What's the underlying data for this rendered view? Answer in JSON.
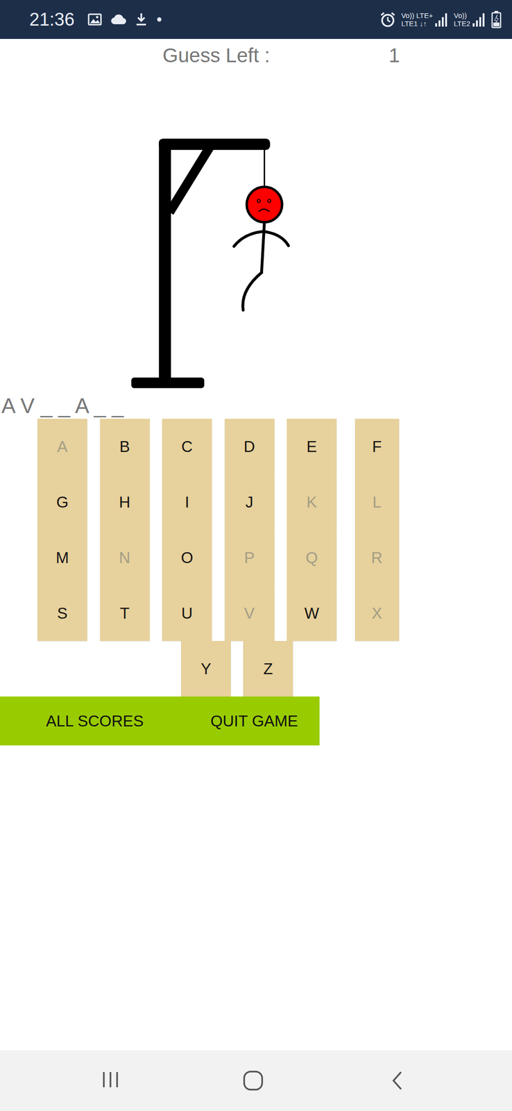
{
  "status_bar": {
    "time": "21:36",
    "sims": [
      {
        "voice": "Vo))",
        "net": "LTE+",
        "slot": "LTE1",
        "activity": "↓↑"
      },
      {
        "voice": "Vo))",
        "slot": "LTE2"
      }
    ],
    "battery": {
      "level": 0.3,
      "charging": true
    }
  },
  "guess": {
    "label": "Guess Left :",
    "value": "1"
  },
  "hangman": {
    "parts": {
      "head": true,
      "body": true,
      "left_arm": true,
      "right_arm": true,
      "left_leg": true,
      "right_leg": false
    }
  },
  "word": "A V _ _ A _ _",
  "keyboard": {
    "rows": [
      [
        {
          "label": "A",
          "disabled": true
        },
        {
          "label": "B",
          "disabled": false
        },
        {
          "label": "C",
          "disabled": false
        },
        {
          "label": "D",
          "disabled": false
        },
        {
          "label": "E",
          "disabled": false
        },
        {
          "label": "F",
          "disabled": false
        }
      ],
      [
        {
          "label": "G",
          "disabled": false
        },
        {
          "label": "H",
          "disabled": false
        },
        {
          "label": "I",
          "disabled": false
        },
        {
          "label": "J",
          "disabled": false
        },
        {
          "label": "K",
          "disabled": true
        },
        {
          "label": "L",
          "disabled": true
        }
      ],
      [
        {
          "label": "M",
          "disabled": false
        },
        {
          "label": "N",
          "disabled": true
        },
        {
          "label": "O",
          "disabled": false
        },
        {
          "label": "P",
          "disabled": true
        },
        {
          "label": "Q",
          "disabled": true
        },
        {
          "label": "R",
          "disabled": true
        }
      ],
      [
        {
          "label": "S",
          "disabled": false
        },
        {
          "label": "T",
          "disabled": false
        },
        {
          "label": "U",
          "disabled": false
        },
        {
          "label": "V",
          "disabled": true
        },
        {
          "label": "W",
          "disabled": false
        },
        {
          "label": "X",
          "disabled": true
        }
      ],
      [
        {
          "label": "Y",
          "disabled": false
        },
        {
          "label": "Z",
          "disabled": false
        }
      ]
    ]
  },
  "buttons": [
    "ALL SCORES",
    "QUIT GAME"
  ]
}
